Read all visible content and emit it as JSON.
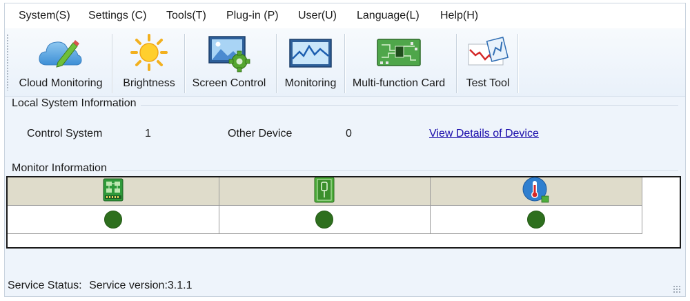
{
  "menu": {
    "system": "System(S)",
    "settings": "Settings (C)",
    "tools": "Tools(T)",
    "plugin": "Plug-in (P)",
    "user": "User(U)",
    "language": "Language(L)",
    "help": "Help(H)"
  },
  "toolbar": {
    "cloud_monitoring": "Cloud Monitoring",
    "brightness": "Brightness",
    "screen_control": "Screen Control",
    "monitoring": "Monitoring",
    "multifunction_card": "Multi-function Card",
    "test_tool": "Test Tool"
  },
  "local_system": {
    "title": "Local System Information",
    "control_system_label": "Control System",
    "control_system_value": "1",
    "other_device_label": "Other Device",
    "other_device_value": "0",
    "view_details_link": "View Details of Device"
  },
  "monitor": {
    "title": "Monitor Information",
    "columns": [
      {
        "icon": "receiving-card-icon",
        "status": "ok",
        "status_color": "#2e6f1e"
      },
      {
        "icon": "sending-card-icon",
        "status": "ok",
        "status_color": "#2e6f1e"
      },
      {
        "icon": "temperature-icon",
        "status": "ok",
        "status_color": "#2e6f1e"
      }
    ]
  },
  "status_bar": {
    "label": "Service Status:",
    "version": "Service version:3.1.1"
  }
}
